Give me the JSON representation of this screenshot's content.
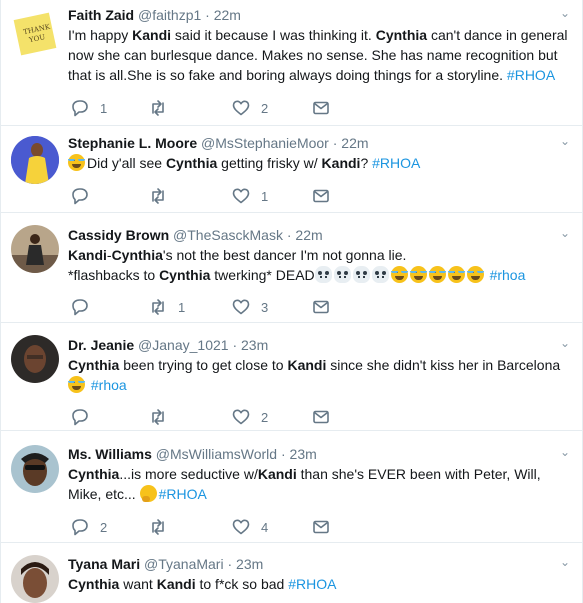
{
  "tweets": [
    {
      "name": "Faith Zaid",
      "handle": "@faithzp1",
      "time": "22m",
      "avatar_icon": "thank-you-note-avatar",
      "text_parts": [
        {
          "t": "I'm happy "
        },
        {
          "t": "Kandi",
          "b": true
        },
        {
          "t": " said it because I was thinking it. "
        },
        {
          "t": "Cynthia",
          "b": true
        },
        {
          "t": " can't dance in general now she can burlesque dance. Makes no sense. She has name recognition but that is all.She is so fake and boring always doing things for a storyline. "
        },
        {
          "t": "#RHOA",
          "tag": true
        }
      ],
      "replies": "1",
      "retweets": "",
      "likes": "2"
    },
    {
      "name": "Stephanie L. Moore",
      "handle": "@MsStephanieMoor",
      "time": "22m",
      "avatar_icon": "yellow-dress-avatar",
      "text_parts": [
        {
          "emoji": "joy"
        },
        {
          "t": "Did y'all see "
        },
        {
          "t": "Cynthia",
          "b": true
        },
        {
          "t": " getting frisky w/ "
        },
        {
          "t": "Kandi",
          "b": true
        },
        {
          "t": "? "
        },
        {
          "t": "#RHOA",
          "tag": true
        }
      ],
      "replies": "",
      "retweets": "",
      "likes": "1"
    },
    {
      "name": "Cassidy Brown",
      "handle": "@TheSasckMask",
      "time": "22m",
      "avatar_icon": "dancer-avatar",
      "text_parts": [
        {
          "t": "Kandi",
          "b": true
        },
        {
          "t": "-"
        },
        {
          "t": "Cynthia",
          "b": true
        },
        {
          "t": "'s not the best dancer I'm not gonna lie."
        },
        {
          "br": true
        },
        {
          "t": "*flashbacks to "
        },
        {
          "t": "Cynthia",
          "b": true
        },
        {
          "t": " twerking*  DEAD"
        },
        {
          "emoji": "skull"
        },
        {
          "emoji": "skull"
        },
        {
          "emoji": "skull"
        },
        {
          "emoji": "skull"
        },
        {
          "emoji": "joy"
        },
        {
          "emoji": "joy"
        },
        {
          "emoji": "joy"
        },
        {
          "emoji": "joy"
        },
        {
          "emoji": "joy"
        },
        {
          "t": " "
        },
        {
          "t": "#rhoa",
          "tag": true
        }
      ],
      "replies": "",
      "retweets": "1",
      "likes": "3"
    },
    {
      "name": "Dr. Jeanie",
      "handle": "@Janay_1021",
      "time": "23m",
      "avatar_icon": "woman-portrait-avatar",
      "text_parts": [
        {
          "t": "Cynthia",
          "b": true
        },
        {
          "t": " been trying to get close to "
        },
        {
          "t": "Kandi",
          "b": true
        },
        {
          "t": " since she didn't kiss her in Barcelona"
        },
        {
          "br": true
        },
        {
          "emoji": "joy"
        },
        {
          "t": " "
        },
        {
          "t": "#rhoa",
          "tag": true
        }
      ],
      "replies": "",
      "retweets": "",
      "likes": "2"
    },
    {
      "name": "Ms. Williams",
      "handle": "@MsWilliamsWorld",
      "time": "23m",
      "avatar_icon": "woman-sunglasses-avatar",
      "text_parts": [
        {
          "t": "Cynthia",
          "b": true
        },
        {
          "t": "...is more seductive w/"
        },
        {
          "t": "Kandi",
          "b": true
        },
        {
          "t": " than she's EVER been with Peter, Will, Mike, etc... "
        },
        {
          "emoji": "think"
        },
        {
          "t": "#RHOA",
          "tag": true
        }
      ],
      "replies": "2",
      "retweets": "",
      "likes": "4"
    },
    {
      "name": "Tyana Mari",
      "handle": "@TyanaMari",
      "time": "23m",
      "avatar_icon": "woman-selfie-avatar",
      "text_parts": [
        {
          "t": "Cynthia",
          "b": true
        },
        {
          "t": " want "
        },
        {
          "t": "Kandi",
          "b": true
        },
        {
          "t": " to f*ck so bad "
        },
        {
          "t": "#RHOA",
          "tag": true
        }
      ],
      "replies": "",
      "retweets": "",
      "likes": ""
    }
  ]
}
